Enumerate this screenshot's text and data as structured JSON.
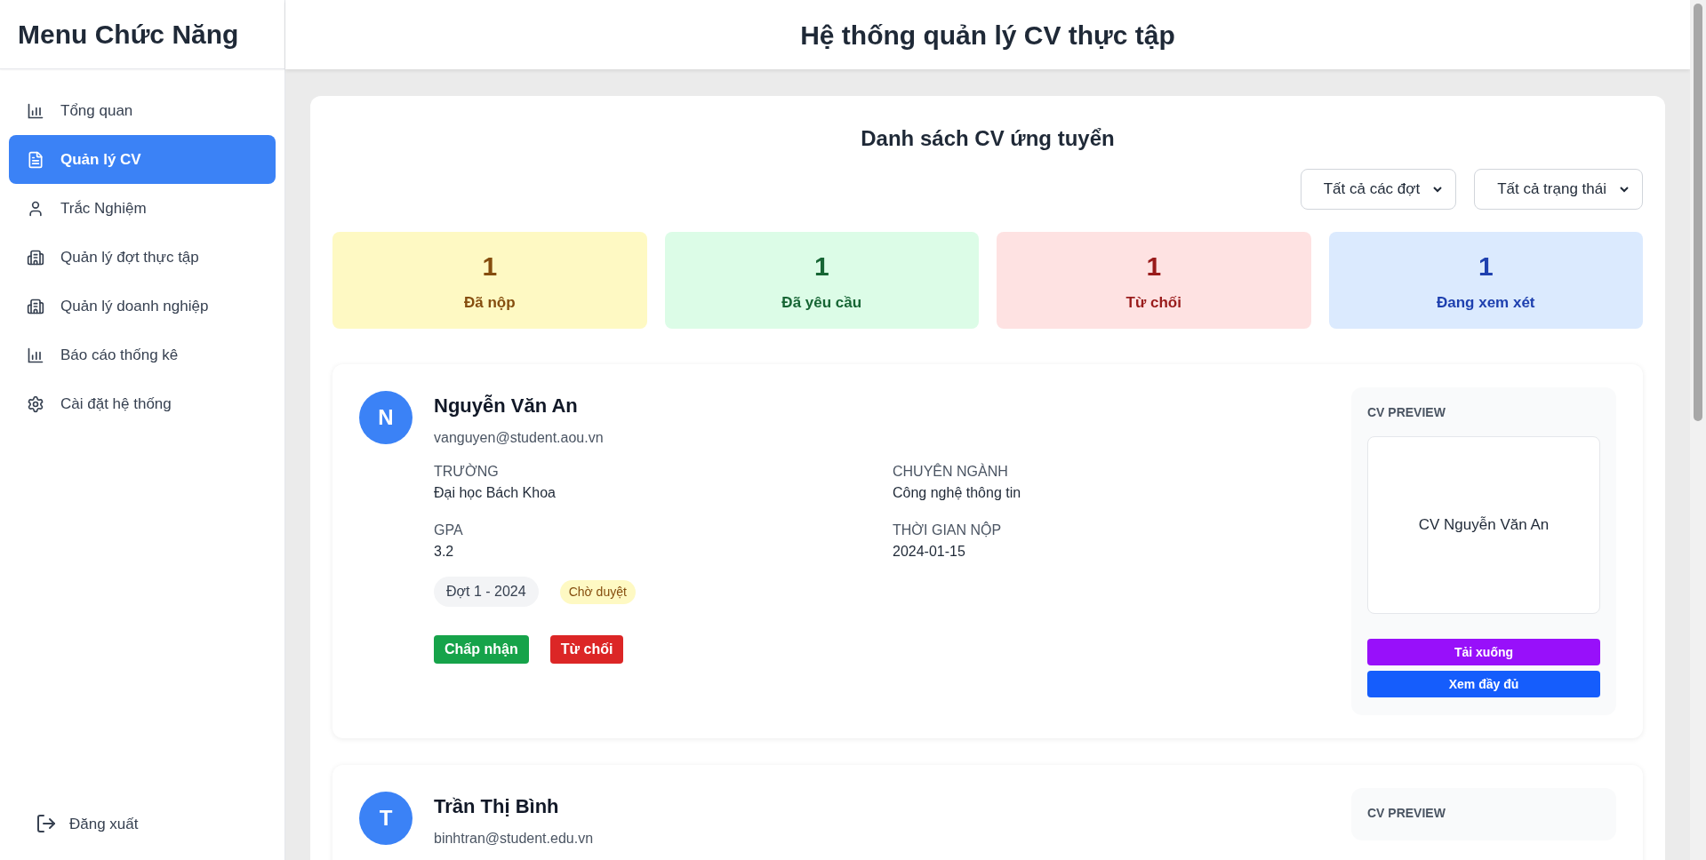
{
  "sidebar": {
    "title": "Menu Chức Năng",
    "items": [
      {
        "label": "Tổng quan",
        "selected": false
      },
      {
        "label": "Quản lý CV",
        "selected": true
      },
      {
        "label": "Trắc Nghiệm",
        "selected": false
      },
      {
        "label": "Quản lý đợt thực tập",
        "selected": false
      },
      {
        "label": "Quản lý doanh nghiệp",
        "selected": false
      },
      {
        "label": "Báo cáo thống kê",
        "selected": false
      },
      {
        "label": "Cài đặt hệ thống",
        "selected": false
      }
    ],
    "logout": "Đăng xuất"
  },
  "header": {
    "title": "Hệ thống quản lý CV thực tập"
  },
  "panel": {
    "title": "Danh sách CV ứng tuyển",
    "filters": [
      {
        "value": "Tất cả các đợt"
      },
      {
        "value": "Tất cả trạng thái"
      }
    ],
    "stats": [
      {
        "count": "1",
        "label": "Đã nộp",
        "color": "#fef9c3"
      },
      {
        "count": "1",
        "label": "Đã yêu cầu",
        "color": "#dcfce7"
      },
      {
        "count": "1",
        "label": "Từ chối",
        "color": "#fee2e2"
      },
      {
        "count": "1",
        "label": "Đang xem xét",
        "color": "#dbeafe"
      }
    ],
    "applicants": [
      {
        "initial": "N",
        "name": "Nguyễn Văn An",
        "email": "vanguyen@student.aou.vn",
        "fields": [
          {
            "label": "TRƯỜNG",
            "value": "Đại học Bách Khoa"
          },
          {
            "label": "CHUYÊN NGÀNH",
            "value": "Công nghệ thông tin"
          },
          {
            "label": "GPA",
            "value": "3.2"
          },
          {
            "label": "THỜI GIAN NỘP",
            "value": "2024-01-15"
          }
        ],
        "batch": "Đợt 1 - 2024",
        "status": {
          "text": "Chờ duyệt",
          "color": "#fef9c3"
        },
        "actions": [
          {
            "label": "Chấp nhận",
            "kind": "accept"
          },
          {
            "label": "Từ chối",
            "kind": "reject"
          }
        ],
        "preview": {
          "label": "CV PREVIEW",
          "document": "CV Nguyễn Văn An",
          "buttons": [
            {
              "label": "Tải xuống",
              "kind": "download"
            },
            {
              "label": "Xem đầy đủ",
              "kind": "view"
            }
          ]
        }
      },
      {
        "initial": "T",
        "name": "Trần Thị Bình",
        "email": "binhtran@student.edu.vn",
        "preview": {
          "label": "CV PREVIEW"
        }
      }
    ]
  }
}
